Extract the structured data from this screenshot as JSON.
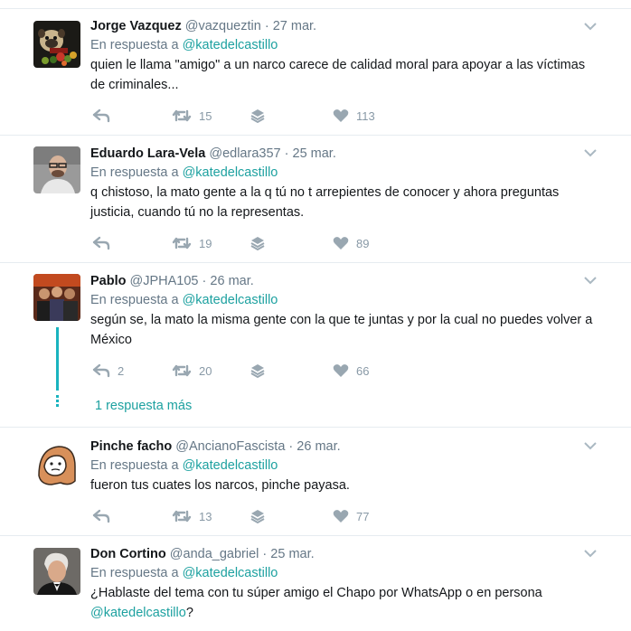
{
  "reply_prefix": "En respuesta a",
  "reply_mention": "@katedelcastillo",
  "tweets": [
    {
      "name": "Jorge Vazquez",
      "handle": "@vazqueztin",
      "date": "27 mar.",
      "text": "quien le llama \"amigo\" a un narco carece de calidad moral para apoyar a las víctimas de criminales...",
      "replies": "",
      "retweets": "15",
      "likes": "113",
      "avatar": "pug-with-vegetables"
    },
    {
      "name": "Eduardo Lara-Vela",
      "handle": "@edlara357",
      "date": "25 mar.",
      "text": "q chistoso, la mato gente a la q tú no t arrepientes de conocer y ahora preguntas justicia, cuando tú no la representas.",
      "replies": "",
      "retweets": "19",
      "likes": "89",
      "avatar": "man-with-glasses"
    },
    {
      "name": "Pablo",
      "handle": "@JPHA105",
      "date": "26 mar.",
      "text": "según se, la mato la misma gente con la que te juntas y por la cual no puedes volver a México",
      "replies": "2",
      "retweets": "20",
      "likes": "66",
      "avatar": "group-photo",
      "more_replies": "1 respuesta más"
    },
    {
      "name": "Pinche facho",
      "handle": "@AncianoFascista",
      "date": "26 mar.",
      "text": "fueron tus cuates los narcos, pinche payasa.",
      "replies": "",
      "retweets": "13",
      "likes": "77",
      "avatar": "hooded-cartoon"
    },
    {
      "name": "Don Cortino",
      "handle": "@anda_gabriel",
      "date": "25 mar.",
      "text_pre": "¿Hablaste del tema con tu súper amigo el Chapo por WhatsApp o en persona",
      "text_mention": "@katedelcastillo",
      "text_post": "?",
      "avatar": "man-in-tuxedo"
    }
  ]
}
